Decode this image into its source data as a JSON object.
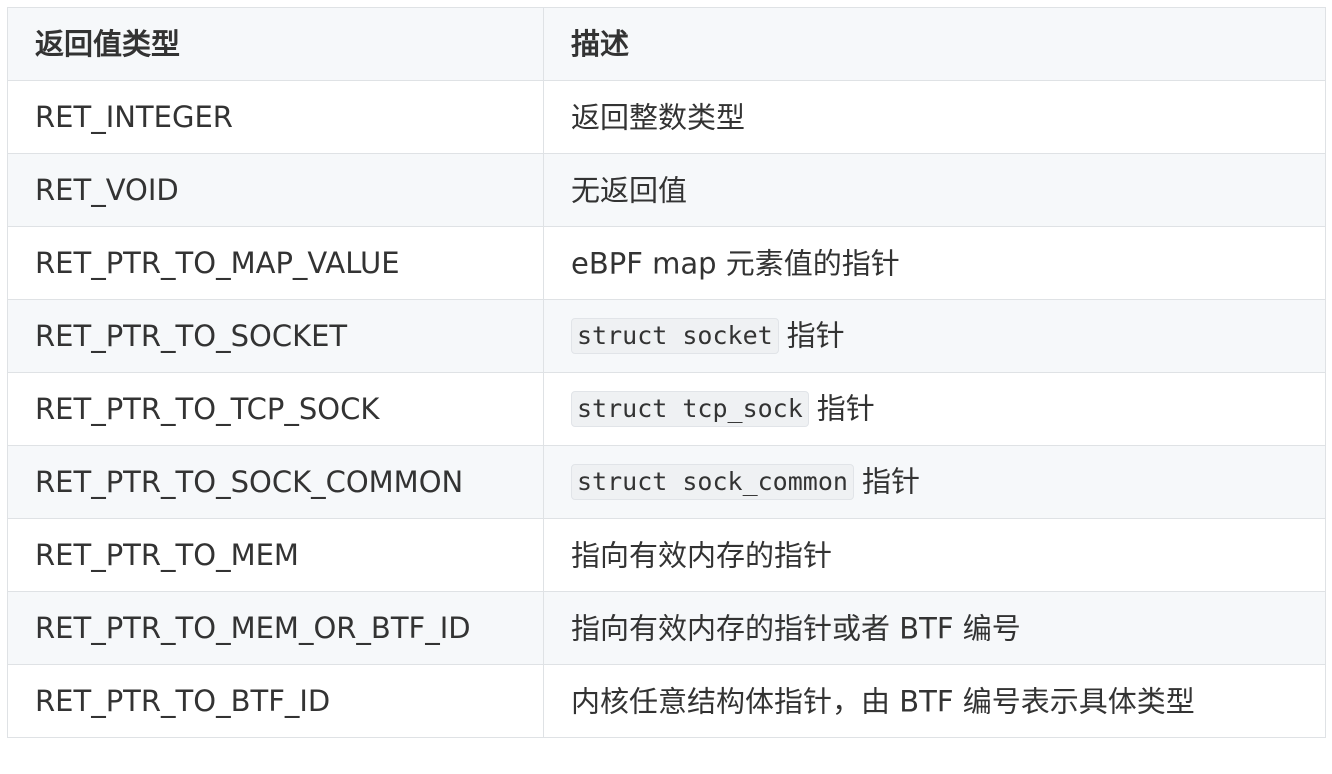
{
  "table": {
    "headers": [
      "返回值类型",
      "描述"
    ],
    "rows": [
      {
        "type": "RET_INTEGER",
        "desc_code": "",
        "desc": "返回整数类型"
      },
      {
        "type": "RET_VOID",
        "desc_code": "",
        "desc": "无返回值"
      },
      {
        "type": "RET_PTR_TO_MAP_VALUE",
        "desc_code": "",
        "desc": "eBPF map 元素值的指针"
      },
      {
        "type": "RET_PTR_TO_SOCKET",
        "desc_code": "struct socket",
        "desc": "指针"
      },
      {
        "type": "RET_PTR_TO_TCP_SOCK",
        "desc_code": "struct tcp_sock",
        "desc": "指针"
      },
      {
        "type": "RET_PTR_TO_SOCK_COMMON",
        "desc_code": "struct sock_common",
        "desc": "指针"
      },
      {
        "type": "RET_PTR_TO_MEM",
        "desc_code": "",
        "desc": "指向有效内存的指针"
      },
      {
        "type": "RET_PTR_TO_MEM_OR_BTF_ID",
        "desc_code": "",
        "desc": "指向有效内存的指针或者 BTF 编号"
      },
      {
        "type": "RET_PTR_TO_BTF_ID",
        "desc_code": "",
        "desc": "内核任意结构体指针，由 BTF 编号表示具体类型"
      }
    ]
  }
}
